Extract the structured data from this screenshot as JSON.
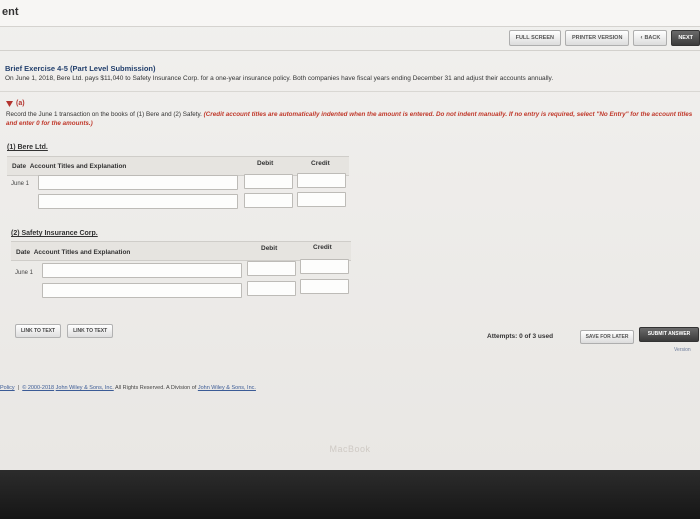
{
  "window": {
    "title": "ent"
  },
  "toolbar": {
    "full_screen": "FULL SCREEN",
    "printer_version": "PRINTER VERSION",
    "back": "BACK",
    "next": "NEXT"
  },
  "exercise": {
    "title": "Brief Exercise 4-5 (Part Level Submission)",
    "description": "On June 1, 2018, Bere Ltd. pays $11,040 to Safety Insurance Corp. for a one-year insurance policy. Both companies have fiscal years ending December 31 and adjust their accounts annually."
  },
  "part_a": {
    "label": "(a)",
    "instruction_plain": "Record the June 1 transaction on the books of (1) Bere and (2) Safety.",
    "instruction_red": "(Credit account titles are automatically indented when the amount is entered. Do not indent manually. If no entry is required, select \"No Entry\" for the account titles and enter 0 for the amounts.)"
  },
  "journal1": {
    "company": "(1) Bere Ltd.",
    "col_date": "Date",
    "col_account": "Account Titles and Explanation",
    "col_debit": "Debit",
    "col_credit": "Credit",
    "row_date": "June 1"
  },
  "journal2": {
    "company": "(2) Safety Insurance Corp.",
    "col_date": "Date",
    "col_account": "Account Titles and Explanation",
    "col_debit": "Debit",
    "col_credit": "Credit",
    "row_date": "June 1"
  },
  "links": {
    "link1": "LINK TO TEXT",
    "link2": "LINK TO TEXT"
  },
  "submission": {
    "attempts": "Attempts: 0 of 3 used",
    "save_later": "SAVE FOR LATER",
    "submit": "SUBMIT ANSWER",
    "version": "Version"
  },
  "footer": {
    "policy": "Policy",
    "separator": "|",
    "copyright": "© 2000-2018",
    "company": "John Wiley & Sons, Inc.",
    "rights": "All Rights Reserved. A Division of",
    "company2": "John Wiley & Sons, Inc."
  },
  "device": {
    "brand": "MacBook"
  }
}
